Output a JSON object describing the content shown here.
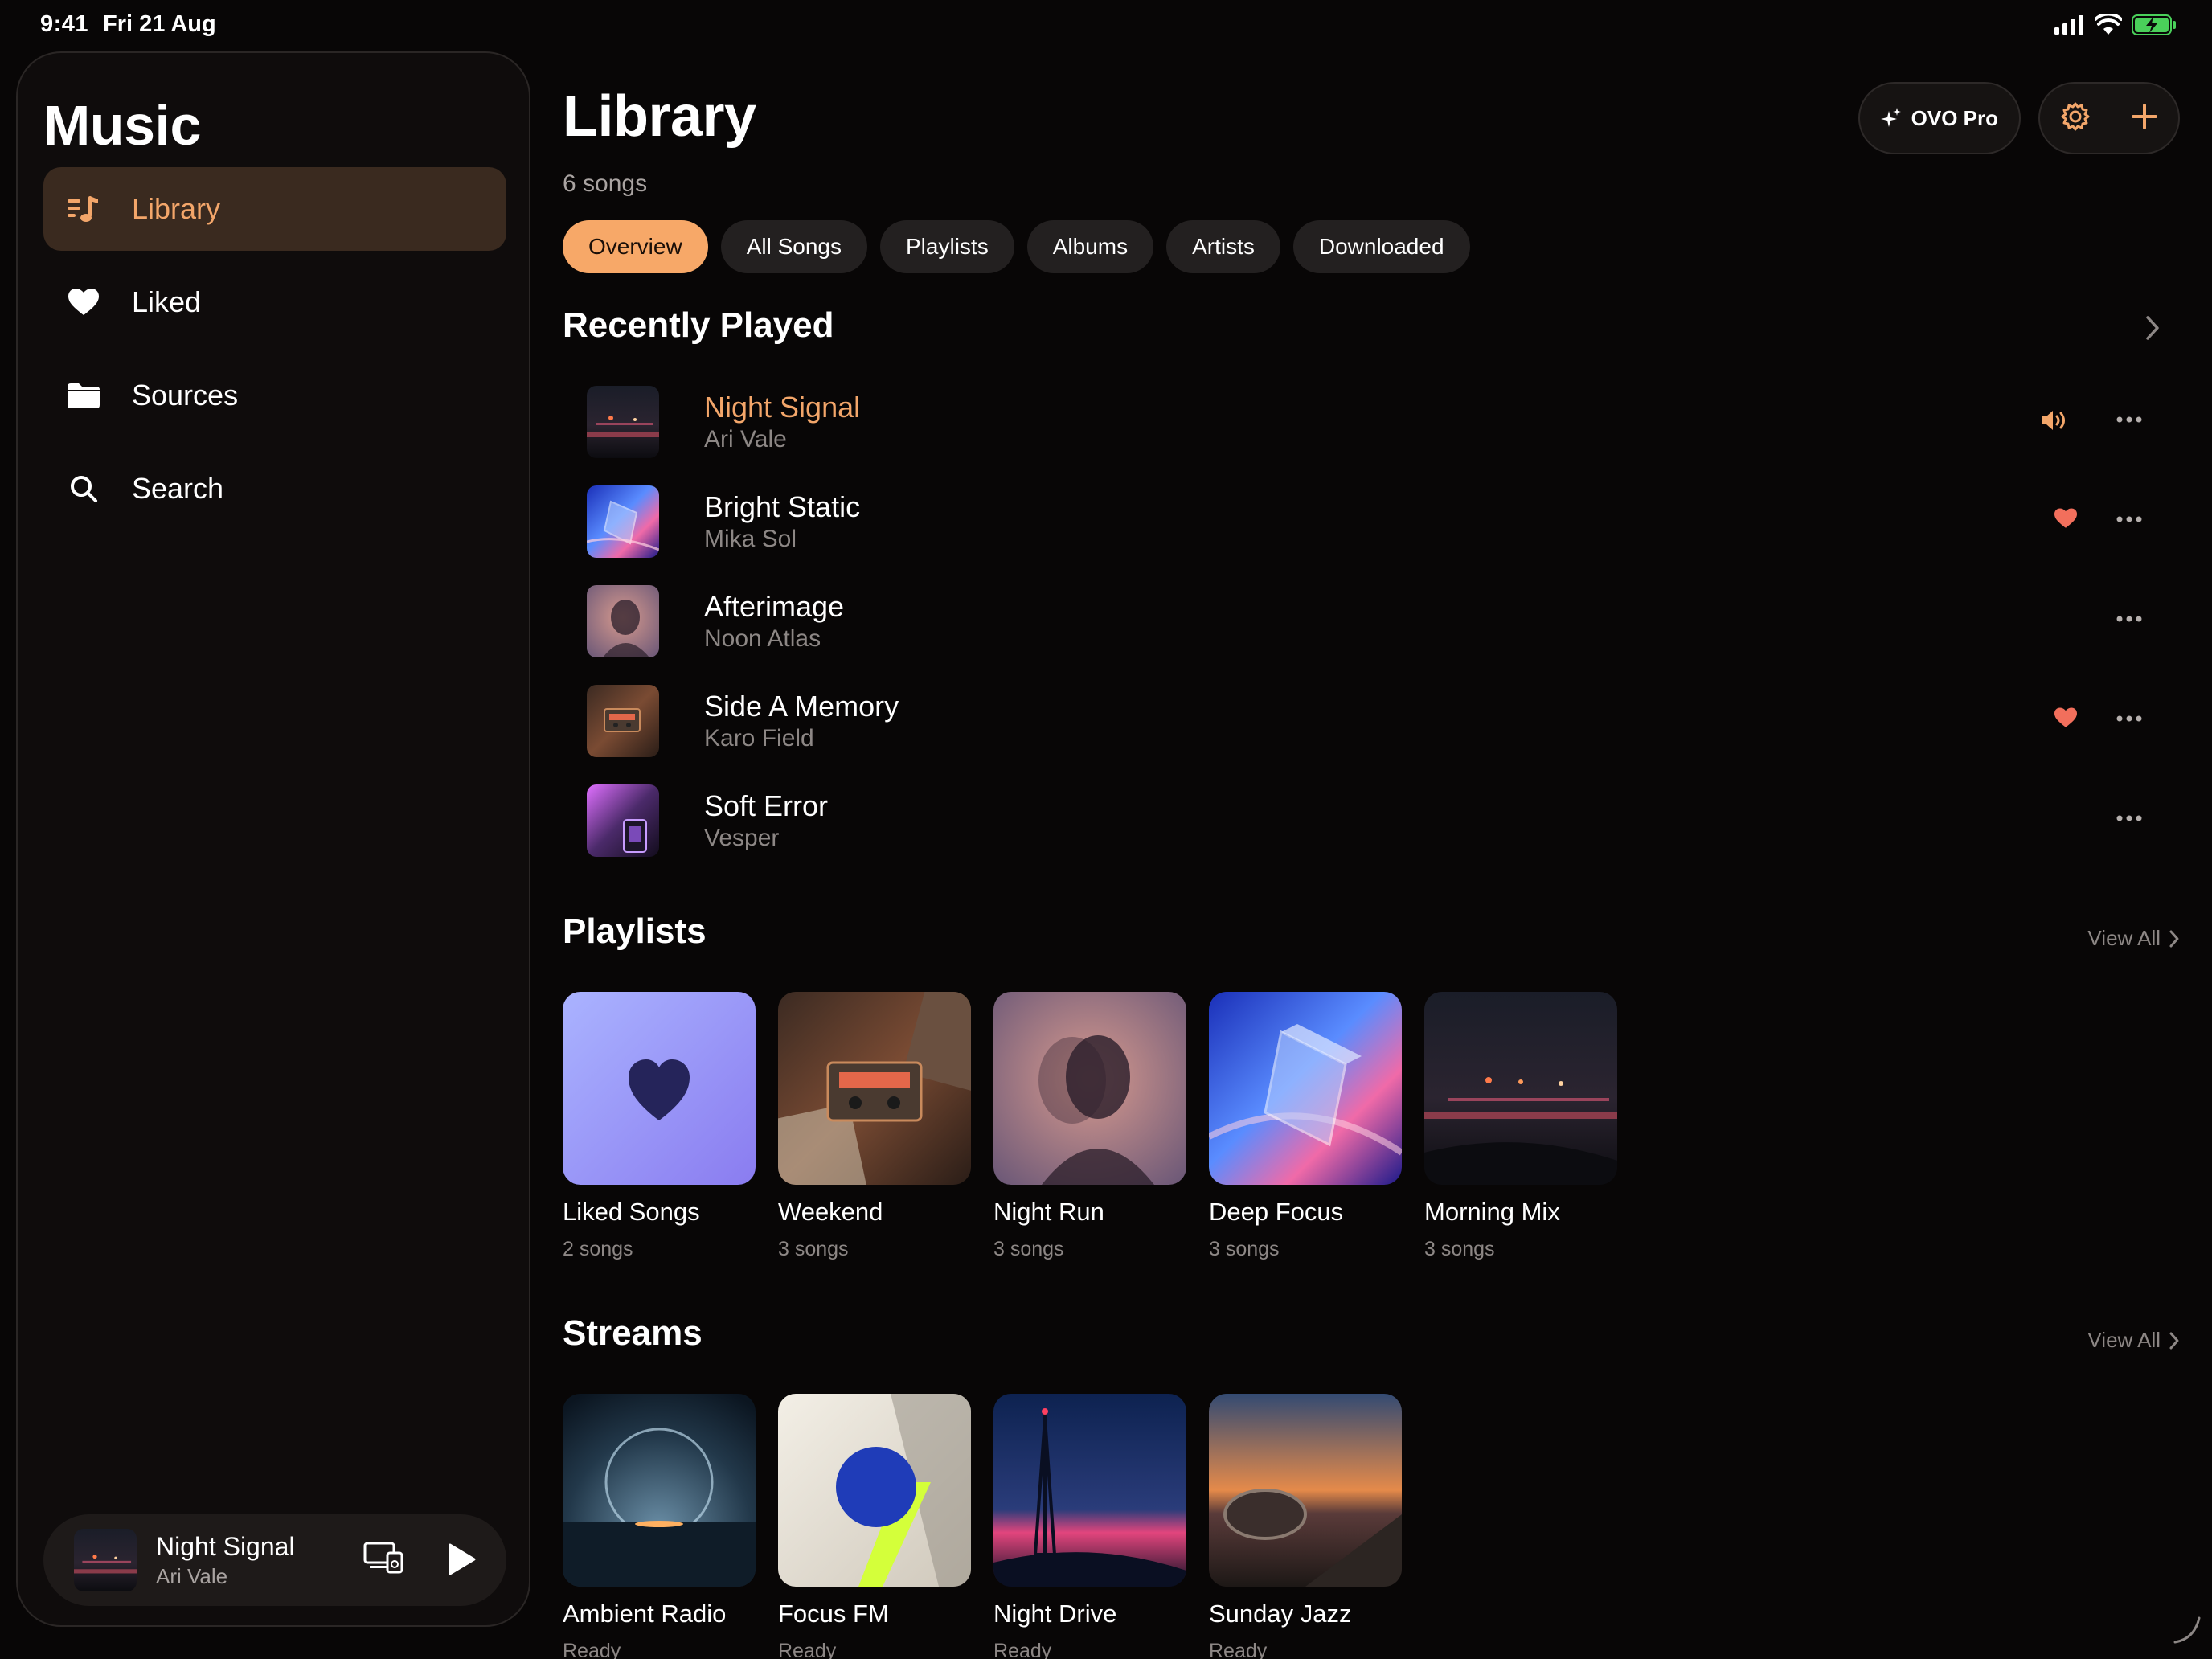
{
  "status": {
    "time": "9:41",
    "date": "Fri 21 Aug"
  },
  "sidebar": {
    "title": "Music",
    "items": [
      {
        "label": "Library",
        "icon": "music-list-icon",
        "active": true
      },
      {
        "label": "Liked",
        "icon": "heart-icon"
      },
      {
        "label": "Sources",
        "icon": "folder-icon"
      },
      {
        "label": "Search",
        "icon": "search-icon"
      }
    ],
    "now_playing": {
      "title": "Night Signal",
      "artist": "Ari Vale"
    }
  },
  "header": {
    "title": "Library",
    "subtitle": "6 songs",
    "pro_label": "OVO Pro"
  },
  "tabs": [
    "Overview",
    "All Songs",
    "Playlists",
    "Albums",
    "Artists",
    "Downloaded"
  ],
  "recently_played": {
    "title": "Recently Played",
    "songs": [
      {
        "title": "Night Signal",
        "artist": "Ari Vale",
        "indicator": "speaker-icon",
        "playing": true
      },
      {
        "title": "Bright Static",
        "artist": "Mika Sol",
        "indicator": "heart-icon"
      },
      {
        "title": "Afterimage",
        "artist": "Noon Atlas",
        "indicator": ""
      },
      {
        "title": "Side A Memory",
        "artist": "Karo Field",
        "indicator": "heart-icon"
      },
      {
        "title": "Soft Error",
        "artist": "Vesper",
        "indicator": ""
      }
    ]
  },
  "playlists": {
    "title": "Playlists",
    "view_all": "View All",
    "items": [
      {
        "title": "Liked Songs",
        "sub": "2 songs"
      },
      {
        "title": "Weekend",
        "sub": "3 songs"
      },
      {
        "title": "Night Run",
        "sub": "3 songs"
      },
      {
        "title": "Deep Focus",
        "sub": "3 songs"
      },
      {
        "title": "Morning Mix",
        "sub": "3 songs"
      }
    ]
  },
  "streams": {
    "title": "Streams",
    "view_all": "View All",
    "items": [
      {
        "title": "Ambient Radio",
        "sub": "Ready"
      },
      {
        "title": "Focus FM",
        "sub": "Ready"
      },
      {
        "title": "Night Drive",
        "sub": "Ready"
      },
      {
        "title": "Sunday Jazz",
        "sub": "Ready"
      }
    ]
  },
  "colors": {
    "accent": "#f3a66a",
    "heart": "#f26f5c",
    "background": "#080606"
  }
}
